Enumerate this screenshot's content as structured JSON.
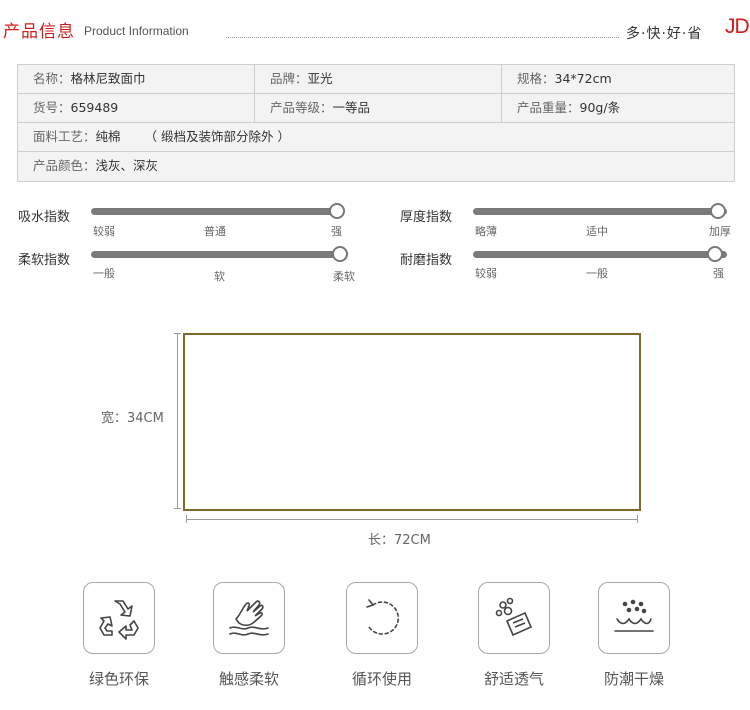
{
  "header": {
    "title": "产品信息",
    "subtitle": "Product Information",
    "slogan": "多·快·好·省",
    "brand": "JD"
  },
  "info": {
    "rows": [
      [
        {
          "label": "名称：",
          "value": "格林尼致面巾"
        },
        {
          "label": "品牌：",
          "value": "亚光"
        },
        {
          "label": "规格：",
          "value": "34*72cm"
        }
      ],
      [
        {
          "label": "货号：",
          "value": "659489"
        },
        {
          "label": "产品等级：",
          "value": "一等品"
        },
        {
          "label": "产品重量：",
          "value": "90g/条"
        }
      ]
    ],
    "material": {
      "label": "面料工艺：",
      "value": "纯棉",
      "note": "（ 缎档及装饰部分除外 ）"
    },
    "color": {
      "label": "产品颜色：",
      "value": "浅灰、深灰"
    }
  },
  "indices": [
    {
      "name": "吸水指数",
      "ticks": [
        "较弱",
        "普通",
        "强"
      ],
      "level": 1.0
    },
    {
      "name": "厚度指数",
      "ticks": [
        "略薄",
        "适中",
        "加厚"
      ],
      "level": 1.0
    },
    {
      "name": "柔软指数",
      "ticks": [
        "一般",
        "软",
        "柔软"
      ],
      "level": 1.0
    },
    {
      "name": "耐磨指数",
      "ticks": [
        "较弱",
        "一般",
        "强"
      ],
      "level": 1.0
    }
  ],
  "diagram": {
    "width_label": "宽：34CM",
    "length_label": "长：72CM"
  },
  "features": [
    {
      "label": "绿色环保",
      "icon": "recycle-icon"
    },
    {
      "label": "触感柔软",
      "icon": "hand-touch-icon"
    },
    {
      "label": "循环使用",
      "icon": "cycle-arrow-icon"
    },
    {
      "label": "舒适透气",
      "icon": "breathable-icon"
    },
    {
      "label": "防潮干燥",
      "icon": "moisture-proof-icon"
    }
  ],
  "colors": {
    "accent": "#d01c1c",
    "towel_border": "#7f6a2e",
    "slider": "#7a7a7a"
  }
}
